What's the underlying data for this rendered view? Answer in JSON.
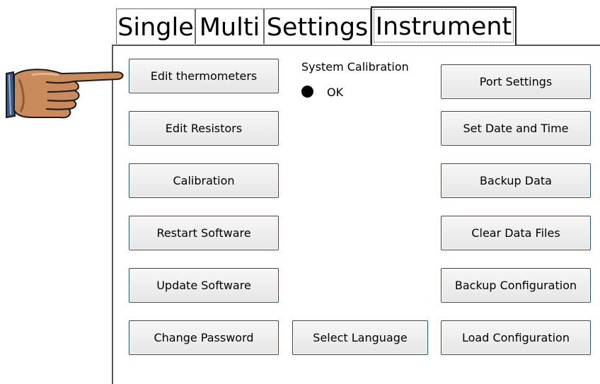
{
  "tabs": [
    {
      "label": "Single",
      "active": false
    },
    {
      "label": "Multi",
      "active": false
    },
    {
      "label": "Settings",
      "active": false
    },
    {
      "label": "Instrument",
      "active": true
    }
  ],
  "left_buttons": [
    {
      "label": "Edit thermometers"
    },
    {
      "label": "Edit Resistors"
    },
    {
      "label": "Calibration"
    },
    {
      "label": "Restart Software"
    },
    {
      "label": "Update Software"
    },
    {
      "label": "Change Password"
    }
  ],
  "center": {
    "system_calibration_label": "System Calibration",
    "calibration_status": "OK",
    "select_language_label": "Select Language"
  },
  "right_buttons": [
    {
      "label": "Port Settings"
    },
    {
      "label": "Set Date and Time"
    },
    {
      "label": "Backup Data"
    },
    {
      "label": "Clear Data Files"
    },
    {
      "label": "Backup Configuration"
    },
    {
      "label": "Load Configuration"
    }
  ],
  "icons": {
    "pointer": "pointing-hand-icon",
    "status": "status-dot-icon"
  },
  "colors": {
    "button_border": "#1f4e79",
    "button_bg": "#efefef",
    "status_dot": "#000000"
  }
}
